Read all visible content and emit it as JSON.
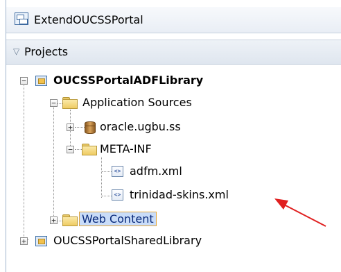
{
  "window": {
    "title": "ExtendOUCSSPortal",
    "icon": "application-icon"
  },
  "projects_panel": {
    "label": "Projects",
    "toggle_icon": "collapse-triangle-icon"
  },
  "tree": {
    "root_project": {
      "label": "OUCSSPortalADFLibrary",
      "icon": "project-icon",
      "expanded": true
    },
    "application_sources": {
      "label": "Application Sources",
      "icon": "folder-icon",
      "expanded": true
    },
    "package": {
      "label": "oracle.ugbu.ss",
      "icon": "package-icon",
      "expanded": false
    },
    "meta_inf": {
      "label": "META-INF",
      "icon": "folder-icon",
      "expanded": true
    },
    "file_adfm": {
      "label": "adfm.xml",
      "icon": "xml-file-icon",
      "glyph": "<>"
    },
    "file_skins": {
      "label": "trinidad-skins.xml",
      "icon": "xml-file-icon",
      "glyph": "<>"
    },
    "web_content": {
      "label": "Web Content",
      "icon": "folder-icon",
      "expanded": false,
      "selected": true
    },
    "shared_library": {
      "label": "OUCSSPortalSharedLibrary",
      "icon": "project-icon",
      "expanded": false
    }
  },
  "colors": {
    "selection_fill": "#c9dcf8",
    "selection_border": "#e4a63a",
    "annotation_arrow": "#e02020"
  },
  "expander": {
    "expanded_symbol": "−",
    "collapsed_symbol": "+"
  }
}
